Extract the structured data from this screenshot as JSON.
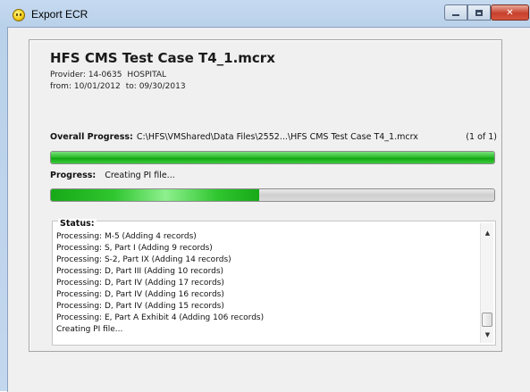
{
  "window": {
    "title": "Export ECR",
    "icon": "app-smiley-icon"
  },
  "header": {
    "file_title": "HFS CMS Test Case T4_1.mcrx",
    "provider_label": "Provider:",
    "provider_id": "14-0635",
    "provider_name": "HOSPITAL",
    "from_label": "from:",
    "from_date": "10/01/2012",
    "to_label": "to:",
    "to_date": "09/30/2013"
  },
  "overall": {
    "label": "Overall Progress:",
    "path": "C:\\HFS\\VMShared\\Data Files\\2552...\\HFS CMS Test Case T4_1.mcrx",
    "count": "(1 of 1)",
    "fraction": 1.0
  },
  "progress": {
    "label": "Progress:",
    "text": "Creating PI file...",
    "fraction": 0.47
  },
  "status": {
    "label": "Status:",
    "lines": [
      "Processing: M-5 (Adding 4 records)",
      "Processing: S, Part I (Adding 9 records)",
      "Processing: S-2, Part IX (Adding 14 records)",
      "Processing: D, Part III (Adding 10 records)",
      "Processing: D, Part IV (Adding 17 records)",
      "Processing: D, Part IV (Adding 16 records)",
      "Processing: D, Part IV (Adding 15 records)",
      "Processing: E, Part A Exhibit 4 (Adding 106 records)",
      "Creating PI file..."
    ],
    "scroll_fraction": 0.92
  },
  "colors": {
    "progress_green": "#13a613",
    "titlebar": "#b9d1ea",
    "close_red": "#c7402d"
  }
}
